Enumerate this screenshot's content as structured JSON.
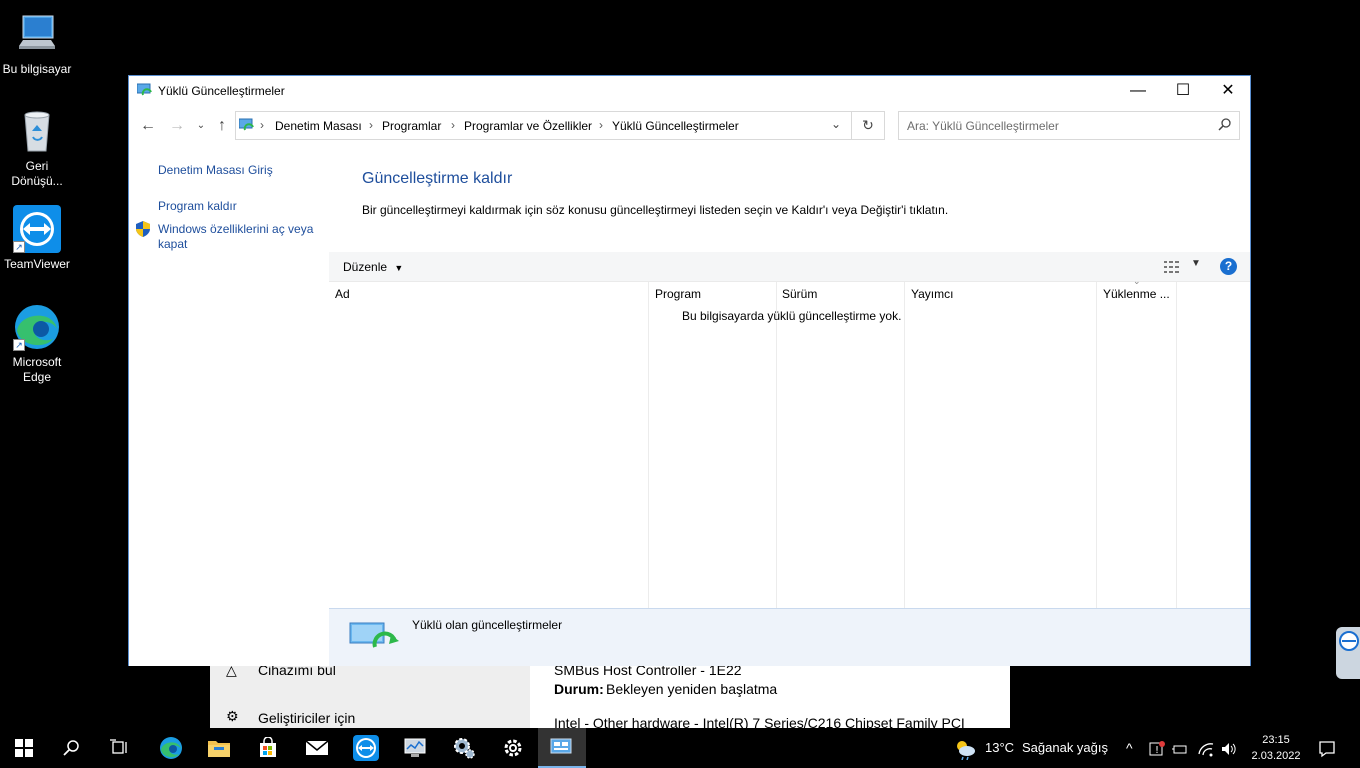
{
  "desktop": {
    "icons": [
      {
        "label": "Bu bilgisayar",
        "icon": "computer-icon"
      },
      {
        "label": "Geri Dönüşü...",
        "icon": "recycle-bin-icon"
      },
      {
        "label": "TeamViewer",
        "icon": "teamviewer-icon"
      },
      {
        "label": "Microsoft Edge",
        "icon": "edge-icon"
      }
    ]
  },
  "background_window": {
    "item1": "Cihazımı bul",
    "item2": "Geliştiriciler için",
    "line1": "SMBus Host Controller - 1E22",
    "status_label": "Durum:",
    "status_value": "Bekleyen yeniden başlatma",
    "line3": "Intel - Other hardware - Intel(R) 7 Series/C216 Chipset Family PCI"
  },
  "window": {
    "title": "Yüklü Güncelleştirmeler",
    "controls": {
      "minimize": "—",
      "maximize": "☐",
      "close": "✕"
    },
    "breadcrumb": [
      "Denetim Masası",
      "Programlar",
      "Programlar ve Özellikler",
      "Yüklü Güncelleştirmeler"
    ],
    "search_placeholder": "Ara: Yüklü Güncelleştirmeler",
    "left_links": [
      "Denetim Masası Giriş",
      "Program kaldır",
      "Windows özelliklerini aç veya kapat"
    ],
    "heading": "Güncelleştirme kaldır",
    "description": "Bir güncelleştirmeyi kaldırmak için söz konusu güncelleştirmeyi listeden seçin ve Kaldır'ı veya Değiştir'i tıklatın.",
    "organize_label": "Düzenle",
    "columns": [
      "Ad",
      "Program",
      "Sürüm",
      "Yayımcı",
      "Yüklenme ..."
    ],
    "empty_message": "Bu bilgisayarda yüklü güncelleştirme yok.",
    "details_text": "Yüklü olan güncelleştirmeler",
    "help_label": "?"
  },
  "taskbar": {
    "weather_temp": "13°C",
    "weather_text": "Sağanak yağış",
    "time": "23:15",
    "date": "2.03.2022"
  }
}
